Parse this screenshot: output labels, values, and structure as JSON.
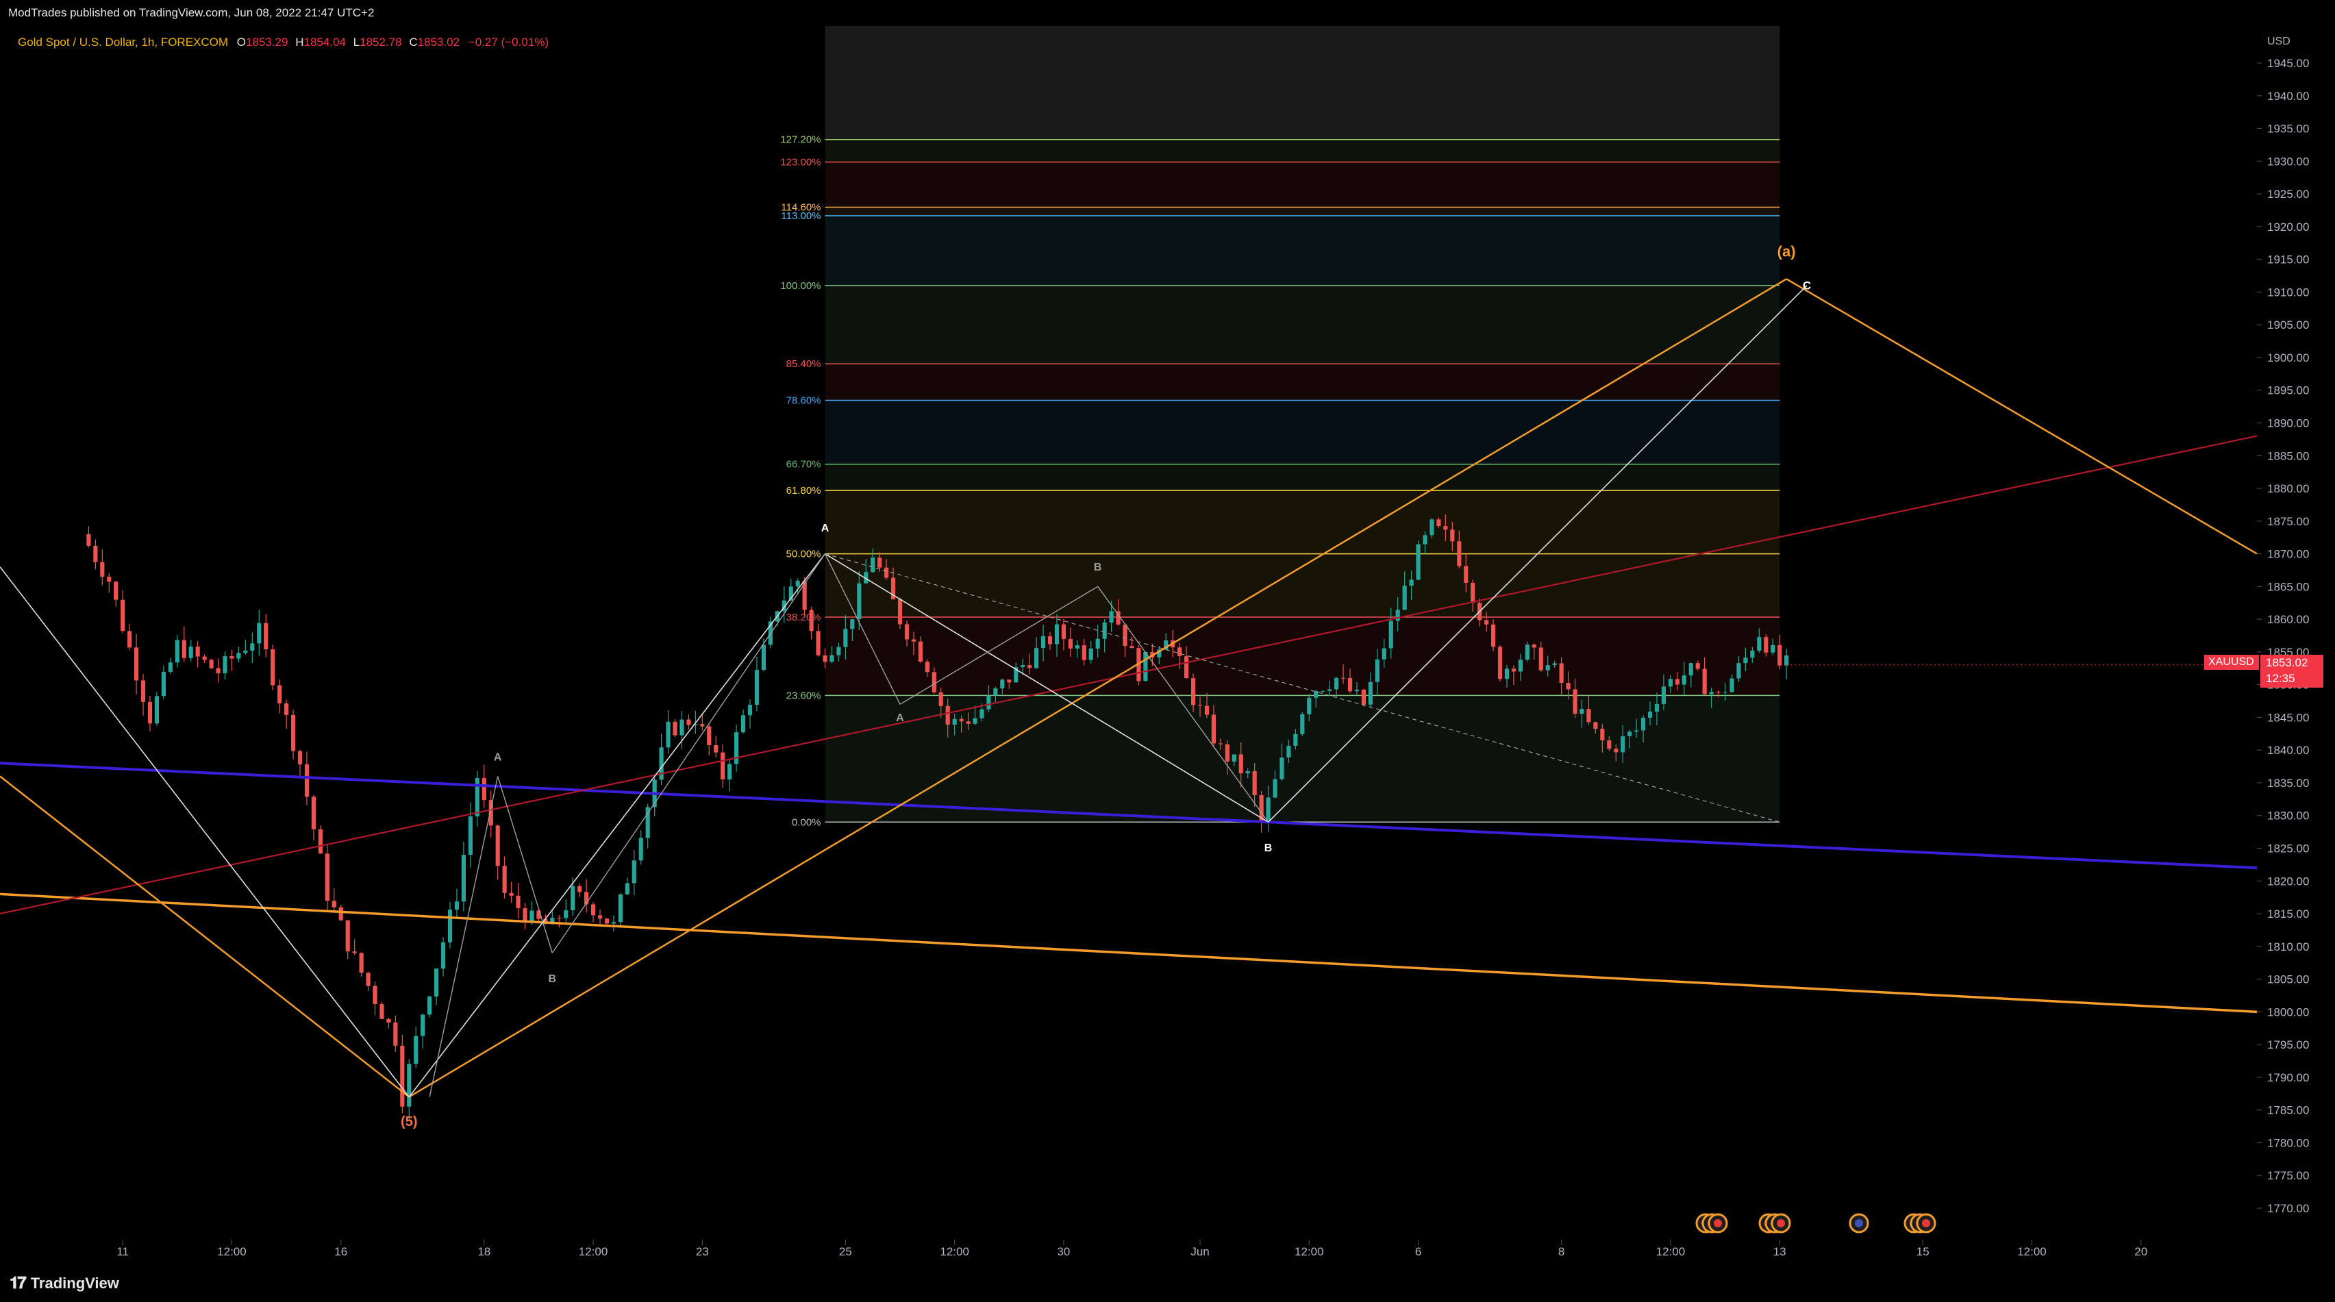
{
  "header": {
    "publisher": "ModTrades published on TradingView.com, Jun 08, 2022 21:47 UTC+2"
  },
  "footer": {
    "brand": "TradingView",
    "logo_icon": "tradingview-logo-icon"
  },
  "colors": {
    "background": "#000000",
    "up_candle": "#26a69a",
    "down_candle": "#ef5350",
    "blue_line": "#3a1fd9",
    "orange_line": "#f59d2c",
    "red_line": "#b2182b",
    "white_line": "#e0e0e0",
    "price_tag": "#f23645"
  },
  "chart_data": {
    "type": "candlestick",
    "title": "Gold Spot / U.S. Dollar, 1h, FOREXCOM",
    "ohlc": {
      "O": "1853.29",
      "H": "1854.04",
      "L": "1852.78",
      "C": "1853.02",
      "change": "−0.27 (−0.01%)"
    },
    "ylabel": "USD",
    "ylim": [
      1765,
      1950
    ],
    "y_ticks": [
      "1945.00",
      "1940.00",
      "1935.00",
      "1930.00",
      "1925.00",
      "1920.00",
      "1915.00",
      "1910.00",
      "1905.00",
      "1900.00",
      "1895.00",
      "1890.00",
      "1885.00",
      "1880.00",
      "1875.00",
      "1870.00",
      "1865.00",
      "1860.00",
      "1855.00",
      "1850.00",
      "1845.00",
      "1840.00",
      "1835.00",
      "1830.00",
      "1825.00",
      "1820.00",
      "1815.00",
      "1810.00",
      "1805.00",
      "1800.00",
      "1795.00",
      "1790.00",
      "1785.00",
      "1780.00",
      "1775.00",
      "1770.00"
    ],
    "x_ticks": [
      "11",
      "12:00",
      "16",
      "18",
      "12:00",
      "23",
      "25",
      "12:00",
      "30",
      "Jun",
      "12:00",
      "6",
      "8",
      "12:00",
      "13",
      "15",
      "12:00",
      "20"
    ],
    "x_tick_index": [
      5,
      21,
      37,
      58,
      74,
      90,
      111,
      127,
      143,
      163,
      179,
      195,
      216,
      232,
      248,
      269,
      285,
      301
    ],
    "x_visible_range": [
      -13,
      318
    ],
    "last_price": {
      "symbol": "XAUUSD",
      "price": "1853.02",
      "countdown": "12:35"
    },
    "candles_price_anchors": [
      [
        0,
        1873
      ],
      [
        4,
        1866
      ],
      [
        10,
        1845
      ],
      [
        14,
        1856
      ],
      [
        20,
        1852
      ],
      [
        26,
        1858
      ],
      [
        32,
        1838
      ],
      [
        36,
        1818
      ],
      [
        40,
        1808
      ],
      [
        44,
        1800
      ],
      [
        46,
        1796
      ],
      [
        47,
        1787
      ],
      [
        50,
        1800
      ],
      [
        55,
        1818
      ],
      [
        58,
        1836
      ],
      [
        62,
        1818
      ],
      [
        66,
        1814
      ],
      [
        69,
        1813
      ],
      [
        72,
        1818
      ],
      [
        75,
        1816
      ],
      [
        78,
        1813
      ],
      [
        82,
        1828
      ],
      [
        86,
        1843
      ],
      [
        90,
        1845
      ],
      [
        94,
        1836
      ],
      [
        98,
        1848
      ],
      [
        102,
        1862
      ],
      [
        105,
        1866
      ],
      [
        108,
        1854
      ],
      [
        112,
        1858
      ],
      [
        116,
        1870
      ],
      [
        120,
        1860
      ],
      [
        124,
        1853
      ],
      [
        127,
        1844
      ],
      [
        131,
        1845
      ],
      [
        135,
        1850
      ],
      [
        139,
        1854
      ],
      [
        143,
        1858
      ],
      [
        147,
        1855
      ],
      [
        151,
        1862
      ],
      [
        155,
        1852
      ],
      [
        159,
        1858
      ],
      [
        163,
        1848
      ],
      [
        167,
        1840
      ],
      [
        171,
        1836
      ],
      [
        173,
        1829
      ],
      [
        176,
        1838
      ],
      [
        180,
        1849
      ],
      [
        184,
        1851
      ],
      [
        188,
        1847
      ],
      [
        192,
        1859
      ],
      [
        196,
        1870
      ],
      [
        198,
        1874
      ],
      [
        201,
        1872
      ],
      [
        204,
        1864
      ],
      [
        208,
        1852
      ],
      [
        212,
        1855
      ],
      [
        216,
        1852
      ],
      [
        220,
        1845
      ],
      [
        224,
        1840
      ],
      [
        228,
        1843
      ],
      [
        232,
        1850
      ],
      [
        236,
        1852
      ],
      [
        240,
        1848
      ],
      [
        244,
        1854
      ],
      [
        246,
        1858
      ],
      [
        249,
        1853
      ]
    ],
    "fib_retracement": {
      "levels": [
        {
          "label": "127.20%",
          "color": "#9ccc65"
        },
        {
          "label": "123.00%",
          "color": "#ef5350"
        },
        {
          "label": "114.60%",
          "color": "#ffb74d"
        },
        {
          "label": "113.00%",
          "color": "#4fc3f7"
        },
        {
          "label": "100.00%",
          "color": "#81c784"
        },
        {
          "label": "85.40%",
          "color": "#ef5350"
        },
        {
          "label": "78.60%",
          "color": "#42a5f5"
        },
        {
          "label": "66.70%",
          "color": "#66bb6a"
        },
        {
          "label": "61.80%",
          "color": "#fdd835"
        },
        {
          "label": "50.00%",
          "color": "#ffd54f"
        },
        {
          "label": "38.20%",
          "color": "#ef5350"
        },
        {
          "label": "23.60%",
          "color": "#81c784"
        },
        {
          "label": "0.00%",
          "color": "#bdbdbd"
        }
      ],
      "price_low": 1829,
      "price_high": 1870
    },
    "wave_labels": [
      {
        "text": "(5)",
        "color": "#ff7043"
      },
      {
        "text": "A",
        "color": "#9e9e9e"
      },
      {
        "text": "B",
        "color": "#9e9e9e"
      },
      {
        "text": "A",
        "color": "#ffffff"
      },
      {
        "text": "A",
        "color": "#9e9e9e"
      },
      {
        "text": "B",
        "color": "#9e9e9e"
      },
      {
        "text": "B",
        "color": "#ffffff"
      },
      {
        "text": "(a)",
        "color": "#f59d2c"
      },
      {
        "text": "C",
        "color": "#ffffff"
      }
    ],
    "event_icons": [
      "economic-events-flag-icon",
      "economic-events-flag-icon",
      "economic-events-flag-icon",
      "economic-events-flag-icon"
    ]
  }
}
